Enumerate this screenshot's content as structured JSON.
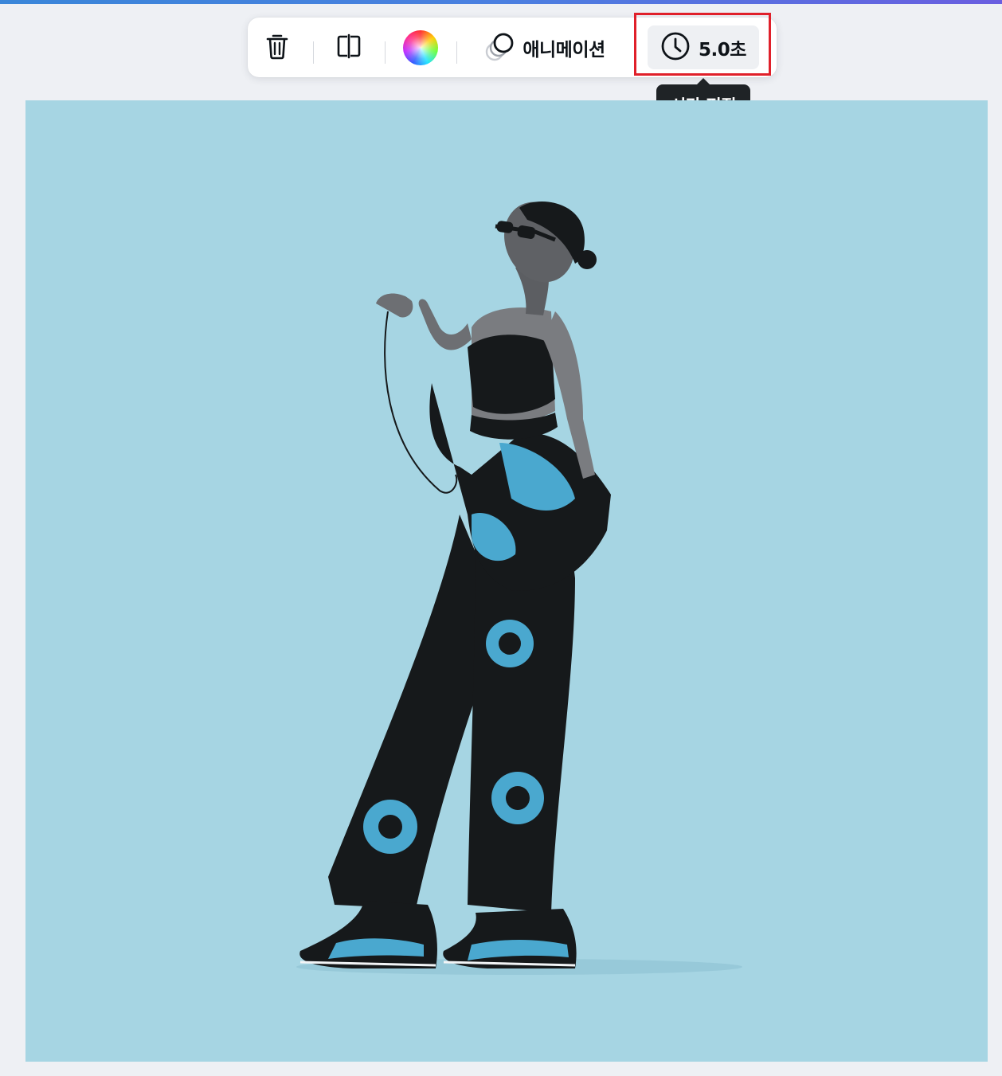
{
  "toolbar": {
    "delete_icon": "trash-icon",
    "flip_icon": "flip-icon",
    "color_icon": "color-wheel-icon",
    "animation": {
      "icon": "animation-icon",
      "label": "애니메이션"
    },
    "timing": {
      "icon": "clock-icon",
      "label": "5.0초"
    }
  },
  "tooltip": {
    "text": "시간 편집"
  },
  "colors": {
    "accent_bar": "#4a7fe0",
    "highlight": "#e0202a",
    "canvas_bg": "#a6d5e3",
    "figure_accent": "#4aa8cf",
    "figure_dark": "#16191b"
  },
  "canvas": {
    "image": "illustration of a woman in sunglasses, black crop top and wide black pants with blue circle prints, holding earphones, wearing sneakers"
  }
}
